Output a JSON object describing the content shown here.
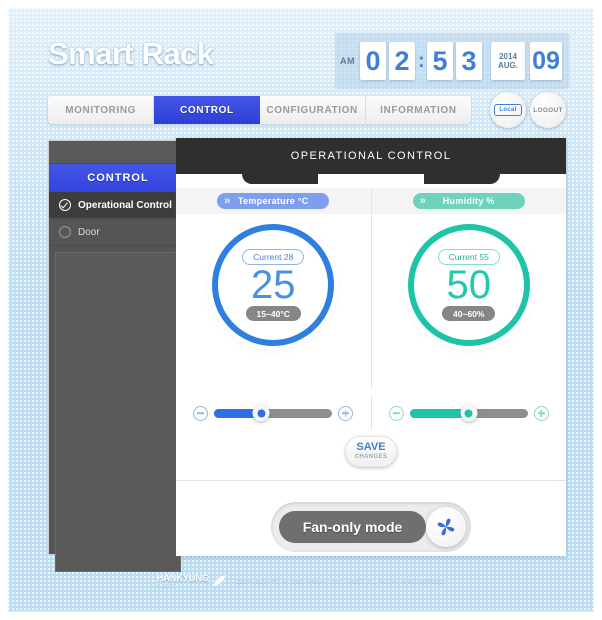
{
  "app": {
    "title": "Smart Rack"
  },
  "clock": {
    "ampm": "AM",
    "h1": "0",
    "h2": "2",
    "colon": ":",
    "m1": "5",
    "m2": "3",
    "year": "2014",
    "month": "AUG.",
    "day": "09"
  },
  "nav": {
    "tabs": [
      {
        "label": "MONITORING",
        "active": false
      },
      {
        "label": "CONTROL",
        "active": true
      },
      {
        "label": "CONFIGURATION",
        "active": false
      },
      {
        "label": "INFORMATION",
        "active": false
      }
    ],
    "local_button": "Local",
    "logout_button": "LOGOUT"
  },
  "sidebar": {
    "title": "CONTROL",
    "items": [
      {
        "label": "Operational Control",
        "selected": true
      },
      {
        "label": "Door",
        "selected": false
      }
    ]
  },
  "panel": {
    "title": "OPERATIONAL CONTROL"
  },
  "temperature": {
    "header": "Temperature °C",
    "current_label": "Current  28",
    "setpoint": "25",
    "range": "15~40°C",
    "slider_percent": "40",
    "minus_label": "−",
    "plus_label": "+",
    "accent": "#2f7fe0"
  },
  "humidity": {
    "header": "Humidity %",
    "current_label": "Current  55",
    "setpoint": "50",
    "range": "40~60%",
    "slider_percent": "50",
    "minus_label": "−",
    "plus_label": "+",
    "accent": "#1fc4a8"
  },
  "save": {
    "line1": "SAVE",
    "line2": "CHANGES"
  },
  "fan": {
    "label": "Fan-only mode",
    "icon": "fan-icon"
  },
  "footer": {
    "brand": "HANKYUNG",
    "brand_sub": "I-NET",
    "copyright": "COPYRIGHTS © 2009 HANKYUNG I-NET ALL RIGHTS RESERVED"
  }
}
